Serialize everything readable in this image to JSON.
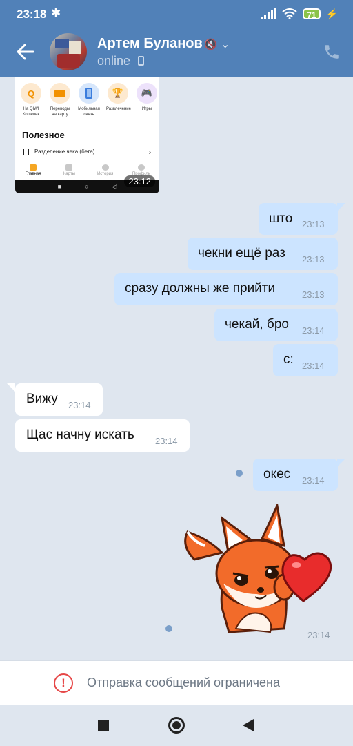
{
  "status_bar": {
    "time": "23:18",
    "bluetooth_icon": "bluetooth-icon",
    "battery": "71"
  },
  "header": {
    "name": "Артем Буланов",
    "status": "online"
  },
  "attachment": {
    "icons": [
      {
        "label": "На QIWI Кошелек",
        "color": "#fde9cf",
        "glyph": "Q"
      },
      {
        "label": "Переводы на карту",
        "color": "#fde9cf",
        "glyph": "▬"
      },
      {
        "label": "Мобильная связь",
        "color": "#d6e6fb",
        "glyph": "▯"
      },
      {
        "label": "Развлечение",
        "color": "#fde9cf",
        "glyph": "🏆"
      },
      {
        "label": "Игры",
        "color": "#ede2fb",
        "glyph": "🎮"
      }
    ],
    "section": "Полезное",
    "item": "Разделение чека (бета)",
    "tabs": [
      "Главная",
      "Карты",
      "История",
      "Профиль"
    ],
    "time": "23:12"
  },
  "messages": [
    {
      "text": "што",
      "time": "23:13"
    },
    {
      "text": "чекни ещё раз",
      "time": "23:13"
    },
    {
      "text": "сразу должны же прийти",
      "time": "23:13"
    },
    {
      "text": "чекай, бро",
      "time": "23:14"
    },
    {
      "text": "с:",
      "time": "23:14"
    },
    {
      "text": "Вижу",
      "time": "23:14"
    },
    {
      "text": "Щас начну искать",
      "time": "23:14"
    },
    {
      "text": "окес",
      "time": "23:14"
    }
  ],
  "sticker": {
    "time": "23:14"
  },
  "restriction": {
    "text": "Отправка сообщений ограничена"
  }
}
